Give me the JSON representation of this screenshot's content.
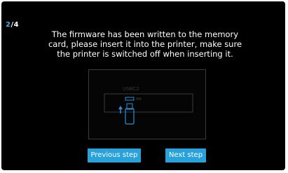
{
  "step": {
    "current": "2",
    "total": "/4"
  },
  "message": "The firmware has been written to the memory card, please insert it into the printer, make sure the printer is switched off when inserting it.",
  "illustration": {
    "port_label": "USBC2",
    "arrow_icon": "arrow-up-icon",
    "drive_icon": "usb-drive-icon",
    "outline_color": "#2a8fd0"
  },
  "buttons": {
    "previous_label": "Previous step",
    "next_label": "Next step"
  },
  "colors": {
    "background": "#000000",
    "accent": "#27a2da",
    "text": "#ffffff"
  }
}
